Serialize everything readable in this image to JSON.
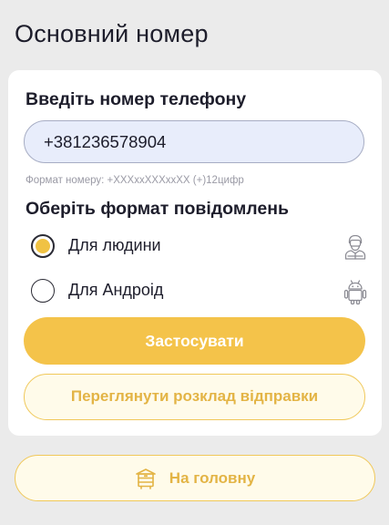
{
  "page": {
    "title": "Основний номер"
  },
  "phone": {
    "label": "Введіть номер телефону",
    "value": "+381236578904",
    "hint": "Формат номеру: +XXXxxXXXxxXX (+)12цифр"
  },
  "format": {
    "label": "Оберіть формат повідомлень",
    "options": [
      {
        "label": "Для людини",
        "selected": true,
        "icon": "person-icon"
      },
      {
        "label": "Для Андроід",
        "selected": false,
        "icon": "android-icon"
      }
    ]
  },
  "buttons": {
    "apply": "Застосувати",
    "schedule": "Переглянути розклад відправки",
    "home": "На головну",
    "home_icon": "beehive-icon"
  },
  "colors": {
    "accent": "#f4c34a",
    "accent_text": "#e3b445",
    "input_bg": "#e8edfb",
    "background": "#ebebeb"
  }
}
